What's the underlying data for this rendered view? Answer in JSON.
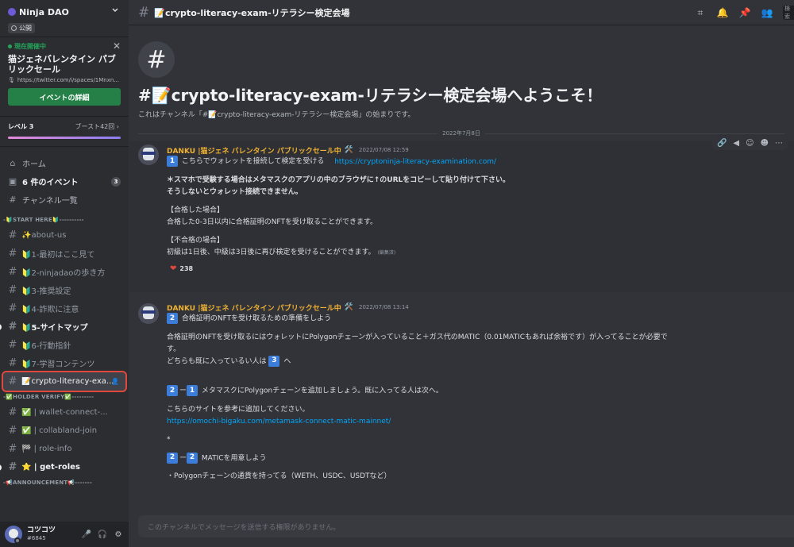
{
  "server": {
    "name": "Ninja DAO",
    "public_label": "公開"
  },
  "event": {
    "status": "現在開催中",
    "title": "猫ジェネバレンタイン パブリックセール",
    "link": "https://twitter.com/i/spaces/1Mnxn...",
    "button": "イベントの詳細"
  },
  "boost": {
    "level": "レベル 3",
    "boosts": "ブースト42回"
  },
  "nav": [
    {
      "label": "ホーム",
      "icon": "home-icon",
      "glyph": "⌂"
    },
    {
      "label": "6 件のイベント",
      "icon": "calendar-icon",
      "glyph": "▣",
      "badge": "3"
    },
    {
      "label": "チャンネル一覧",
      "icon": "browse-channels-icon",
      "glyph": "#"
    }
  ],
  "categories": [
    {
      "name": "-🔰START HERE🔰----------",
      "channels": [
        {
          "label": "✨about-us",
          "unread": false
        },
        {
          "label": "🔰1-最初はここ見て",
          "unread": false,
          "icon": "☑"
        },
        {
          "label": "🔰2-ninjadaoの歩き方",
          "unread": false
        },
        {
          "label": "🔰3-推奨設定",
          "unread": false
        },
        {
          "label": "🔰4-詐欺に注意",
          "unread": false
        },
        {
          "label": "🔰5-サイトマップ",
          "unread": true
        },
        {
          "label": "🔰6-行動指針",
          "unread": false
        },
        {
          "label": "🔰7-学習コンテンツ",
          "unread": false
        },
        {
          "label": "📝crypto-literacy-exa...",
          "unread": false,
          "selected": true
        }
      ]
    },
    {
      "name": "-✅HOLDER VERIFY✅---------",
      "channels": [
        {
          "label": "✅ | wallet-connect-...",
          "unread": false
        },
        {
          "label": "✅ | collabland-join",
          "unread": false
        },
        {
          "label": "🏁 | role-info",
          "unread": false
        },
        {
          "label": "⭐ | get-roles",
          "unread": true
        }
      ]
    },
    {
      "name": "-📢ANNOUNCEMENT📢-------",
      "channels": []
    }
  ],
  "user": {
    "name": "コツコツ",
    "tag": "#6845"
  },
  "channel": {
    "name": "📝crypto-literacy-exam-リテラシー検定会場",
    "welcome_title": "#📝crypto-literacy-exam-リテラシー検定会場へようこそ！",
    "welcome_sub": "これはチャンネル「#📝crypto-literacy-exam-リテラシー検定会場」の始まりです。",
    "search_placeholder": "検索"
  },
  "date_divider": "2022年7月8日",
  "messages": [
    {
      "author": "DANKU |猫ジェネ バレンタイン パブリックセール中",
      "author_emoji": "🛠️",
      "timestamp": "2022/07/08 12:59",
      "line1_num": "1",
      "line1": "こちらでウォレットを接続して検定を受ける",
      "line1_link": "https://cryptoninja-literacy-examination.com/",
      "bold1": "＊スマホで受験する場合はメタマスクのアプリの中のブラウザに↑のURLをコピーして貼り付けて下さい。",
      "bold2": "そうしないとウォレット接続できません。",
      "pass_header": "【合格した場合】",
      "pass_body": "合格した0-3日以内に合格証明のNFTを受け取ることができます。",
      "fail_header": "【不合格の場合】",
      "fail_body": "初級は1日後、中級は3日後に再び検定を受けることができます。",
      "edited": "(編集済)",
      "reaction_count": "238"
    },
    {
      "author": "DANKU |猫ジェネ バレンタイン パブリックセール中",
      "author_emoji": "🛠️",
      "timestamp": "2022/07/08 13:14",
      "line1_num": "2",
      "line1": "合格証明のNFTを受け取るための準備をしよう",
      "body1": "合格証明のNFTを受け取るにはウォレットにPolygonチェーンが入っていること＋ガス代のMATIC（0.01MATICもあれば余裕です）が入ってることが必要で",
      "body1b": "す。",
      "body2_pre": "どちらも既に入っているい人は",
      "body2_num": "3",
      "body2_post": "へ",
      "step21_a": "2",
      "step21_sep": "ー",
      "step21_b": "1",
      "step21_text": "メタマスクにPolygonチェーンを追加しましょう。既に入ってる人は次へ。",
      "ref_text": "こちらのサイトを参考に追加してください。",
      "ref_link": "https://omochi-bigaku.com/metamask-connect-matic-mainnet/",
      "asterisk": "*",
      "step22_a": "2",
      "step22_sep": "ー",
      "step22_b": "2",
      "step22_text": "MATICを用意しよう",
      "partial": "・Polygonチェーンの通貨を持ってる（WETH、USDC、USDTなど）"
    }
  ],
  "composer_placeholder": "このチャンネルでメッセージを送信する権限がありません。"
}
